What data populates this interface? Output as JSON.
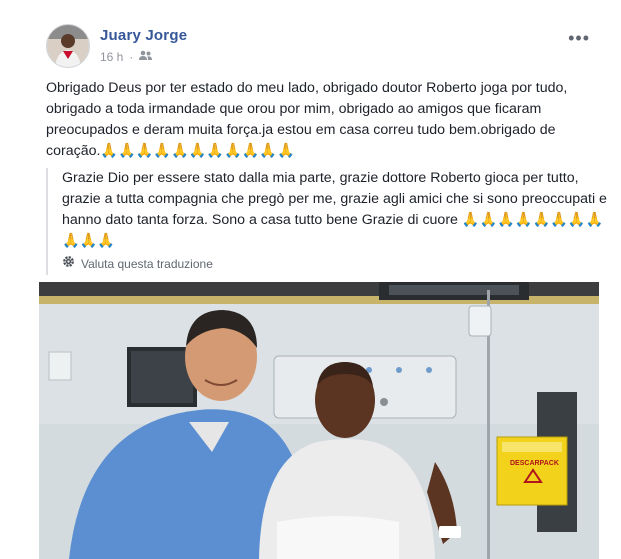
{
  "post": {
    "author": "Juary Jorge",
    "time": "16 h",
    "separator": "·",
    "privacy_icon": "friends-icon",
    "more_icon": "more-dots-icon",
    "more_label": "•••",
    "text_pt": "Obrigado Deus por ter estado do meu lado, obrigado doutor Roberto joga por tudo, obrigado a toda irmandade que orou por mim, obrigado ao amigos que ficaram preocupados e deram muita força.ja estou em casa correu tudo bem.obrigado de coração.",
    "emoji_pt": "🙏🙏🙏🙏🙏🙏🙏🙏🙏🙏🙏",
    "text_it": "Grazie Dio per essere stato dalla mia parte, grazie dottore Roberto gioca per tutto, grazie a tutta compagnia che pregò per me, grazie agli amici che si sono preoccupati e hanno dato tanta forza. Sono a casa tutto bene Grazie di cuore",
    "emoji_it": "🙏🙏🙏🙏🙏🙏🙏🙏🙏🙏🙏",
    "translate_icon": "gear-icon",
    "translate_label": "Valuta questa traduzione"
  },
  "photo": {
    "sign_label": "DESCARPACK"
  },
  "colors": {
    "author": "#365899",
    "meta": "#90949c",
    "scrubs": "#5b8fd1",
    "box": "#f2d21a"
  }
}
